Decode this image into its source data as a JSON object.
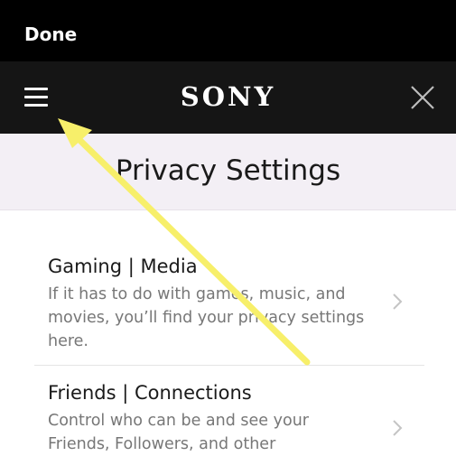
{
  "topbar": {
    "done_label": "Done"
  },
  "navbar": {
    "menu_icon": "hamburger-menu-icon",
    "logo_text": "SONY",
    "close_icon": "close-icon"
  },
  "page": {
    "title": "Privacy Settings"
  },
  "items": [
    {
      "title": "Gaming | Media",
      "description": "If it has to do with games, music, and movies, you’ll find your privacy settings here.",
      "icon": "chevron-right-icon"
    },
    {
      "title": "Friends | Connections",
      "description": "Control who can be and see your Friends, Followers, and other",
      "icon": "chevron-right-icon"
    }
  ],
  "colors": {
    "topbar_bg": "#000000",
    "navbar_bg": "#151515",
    "title_band_bg": "#f3eff5",
    "annotation_arrow": "#f7ef6a"
  }
}
